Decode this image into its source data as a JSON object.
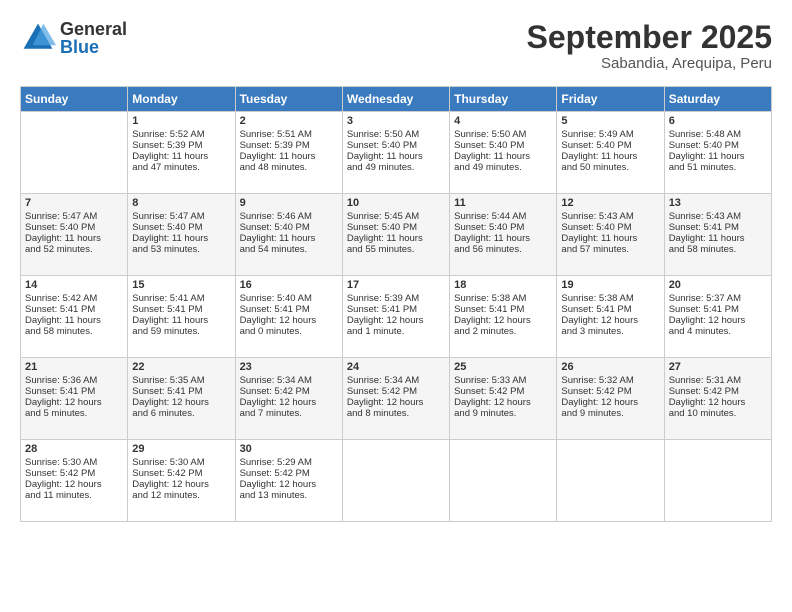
{
  "logo": {
    "general": "General",
    "blue": "Blue"
  },
  "title": "September 2025",
  "subtitle": "Sabandia, Arequipa, Peru",
  "days": [
    "Sunday",
    "Monday",
    "Tuesday",
    "Wednesday",
    "Thursday",
    "Friday",
    "Saturday"
  ],
  "weeks": [
    [
      {
        "num": "",
        "lines": []
      },
      {
        "num": "1",
        "lines": [
          "Sunrise: 5:52 AM",
          "Sunset: 5:39 PM",
          "Daylight: 11 hours",
          "and 47 minutes."
        ]
      },
      {
        "num": "2",
        "lines": [
          "Sunrise: 5:51 AM",
          "Sunset: 5:39 PM",
          "Daylight: 11 hours",
          "and 48 minutes."
        ]
      },
      {
        "num": "3",
        "lines": [
          "Sunrise: 5:50 AM",
          "Sunset: 5:40 PM",
          "Daylight: 11 hours",
          "and 49 minutes."
        ]
      },
      {
        "num": "4",
        "lines": [
          "Sunrise: 5:50 AM",
          "Sunset: 5:40 PM",
          "Daylight: 11 hours",
          "and 49 minutes."
        ]
      },
      {
        "num": "5",
        "lines": [
          "Sunrise: 5:49 AM",
          "Sunset: 5:40 PM",
          "Daylight: 11 hours",
          "and 50 minutes."
        ]
      },
      {
        "num": "6",
        "lines": [
          "Sunrise: 5:48 AM",
          "Sunset: 5:40 PM",
          "Daylight: 11 hours",
          "and 51 minutes."
        ]
      }
    ],
    [
      {
        "num": "7",
        "lines": [
          "Sunrise: 5:47 AM",
          "Sunset: 5:40 PM",
          "Daylight: 11 hours",
          "and 52 minutes."
        ]
      },
      {
        "num": "8",
        "lines": [
          "Sunrise: 5:47 AM",
          "Sunset: 5:40 PM",
          "Daylight: 11 hours",
          "and 53 minutes."
        ]
      },
      {
        "num": "9",
        "lines": [
          "Sunrise: 5:46 AM",
          "Sunset: 5:40 PM",
          "Daylight: 11 hours",
          "and 54 minutes."
        ]
      },
      {
        "num": "10",
        "lines": [
          "Sunrise: 5:45 AM",
          "Sunset: 5:40 PM",
          "Daylight: 11 hours",
          "and 55 minutes."
        ]
      },
      {
        "num": "11",
        "lines": [
          "Sunrise: 5:44 AM",
          "Sunset: 5:40 PM",
          "Daylight: 11 hours",
          "and 56 minutes."
        ]
      },
      {
        "num": "12",
        "lines": [
          "Sunrise: 5:43 AM",
          "Sunset: 5:40 PM",
          "Daylight: 11 hours",
          "and 57 minutes."
        ]
      },
      {
        "num": "13",
        "lines": [
          "Sunrise: 5:43 AM",
          "Sunset: 5:41 PM",
          "Daylight: 11 hours",
          "and 58 minutes."
        ]
      }
    ],
    [
      {
        "num": "14",
        "lines": [
          "Sunrise: 5:42 AM",
          "Sunset: 5:41 PM",
          "Daylight: 11 hours",
          "and 58 minutes."
        ]
      },
      {
        "num": "15",
        "lines": [
          "Sunrise: 5:41 AM",
          "Sunset: 5:41 PM",
          "Daylight: 11 hours",
          "and 59 minutes."
        ]
      },
      {
        "num": "16",
        "lines": [
          "Sunrise: 5:40 AM",
          "Sunset: 5:41 PM",
          "Daylight: 12 hours",
          "and 0 minutes."
        ]
      },
      {
        "num": "17",
        "lines": [
          "Sunrise: 5:39 AM",
          "Sunset: 5:41 PM",
          "Daylight: 12 hours",
          "and 1 minute."
        ]
      },
      {
        "num": "18",
        "lines": [
          "Sunrise: 5:38 AM",
          "Sunset: 5:41 PM",
          "Daylight: 12 hours",
          "and 2 minutes."
        ]
      },
      {
        "num": "19",
        "lines": [
          "Sunrise: 5:38 AM",
          "Sunset: 5:41 PM",
          "Daylight: 12 hours",
          "and 3 minutes."
        ]
      },
      {
        "num": "20",
        "lines": [
          "Sunrise: 5:37 AM",
          "Sunset: 5:41 PM",
          "Daylight: 12 hours",
          "and 4 minutes."
        ]
      }
    ],
    [
      {
        "num": "21",
        "lines": [
          "Sunrise: 5:36 AM",
          "Sunset: 5:41 PM",
          "Daylight: 12 hours",
          "and 5 minutes."
        ]
      },
      {
        "num": "22",
        "lines": [
          "Sunrise: 5:35 AM",
          "Sunset: 5:41 PM",
          "Daylight: 12 hours",
          "and 6 minutes."
        ]
      },
      {
        "num": "23",
        "lines": [
          "Sunrise: 5:34 AM",
          "Sunset: 5:42 PM",
          "Daylight: 12 hours",
          "and 7 minutes."
        ]
      },
      {
        "num": "24",
        "lines": [
          "Sunrise: 5:34 AM",
          "Sunset: 5:42 PM",
          "Daylight: 12 hours",
          "and 8 minutes."
        ]
      },
      {
        "num": "25",
        "lines": [
          "Sunrise: 5:33 AM",
          "Sunset: 5:42 PM",
          "Daylight: 12 hours",
          "and 9 minutes."
        ]
      },
      {
        "num": "26",
        "lines": [
          "Sunrise: 5:32 AM",
          "Sunset: 5:42 PM",
          "Daylight: 12 hours",
          "and 9 minutes."
        ]
      },
      {
        "num": "27",
        "lines": [
          "Sunrise: 5:31 AM",
          "Sunset: 5:42 PM",
          "Daylight: 12 hours",
          "and 10 minutes."
        ]
      }
    ],
    [
      {
        "num": "28",
        "lines": [
          "Sunrise: 5:30 AM",
          "Sunset: 5:42 PM",
          "Daylight: 12 hours",
          "and 11 minutes."
        ]
      },
      {
        "num": "29",
        "lines": [
          "Sunrise: 5:30 AM",
          "Sunset: 5:42 PM",
          "Daylight: 12 hours",
          "and 12 minutes."
        ]
      },
      {
        "num": "30",
        "lines": [
          "Sunrise: 5:29 AM",
          "Sunset: 5:42 PM",
          "Daylight: 12 hours",
          "and 13 minutes."
        ]
      },
      {
        "num": "",
        "lines": []
      },
      {
        "num": "",
        "lines": []
      },
      {
        "num": "",
        "lines": []
      },
      {
        "num": "",
        "lines": []
      }
    ]
  ]
}
